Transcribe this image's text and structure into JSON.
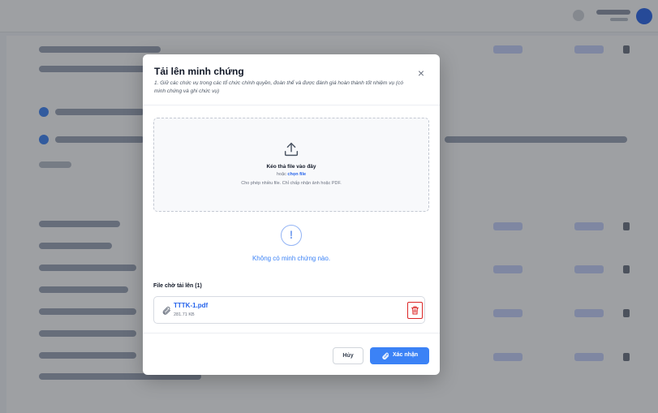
{
  "modal": {
    "title": "Tải lên minh chứng",
    "subtitle": "1. Giữ các chức vụ trong các tổ chức chính quyền, đoàn thể và được đánh giá hoàn thành tốt nhiệm vụ (có minh chứng và ghi chức vụ)",
    "close_icon": "close-icon"
  },
  "dropzone": {
    "icon": "upload-icon",
    "title": "Kéo thả file vào đây",
    "or_text": "hoặc",
    "choose_link": "chọn file",
    "hint": "Cho phép nhiều file. Chỉ chấp nhận ảnh hoặc PDF."
  },
  "empty_state": {
    "icon": "info-circle-icon",
    "text": "Không có minh chứng nào."
  },
  "pending": {
    "label": "File chờ tải lên (1)",
    "files": [
      {
        "name": "TTTK-1.pdf",
        "size": "281.71 KB",
        "icon": "paperclip-icon",
        "delete_icon": "trash-icon"
      }
    ]
  },
  "footer": {
    "cancel_label": "Hủy",
    "confirm_label": "Xác nhận",
    "confirm_icon": "paperclip-icon"
  },
  "colors": {
    "accent": "#3b82f6",
    "danger": "#dc2626",
    "overlay": "rgba(40,44,52,0.45)"
  }
}
